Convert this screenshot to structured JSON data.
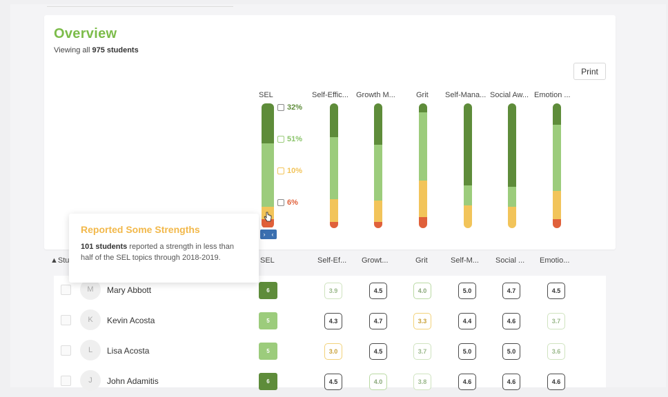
{
  "overview": {
    "title": "Overview",
    "subtitle_prefix": "Viewing all ",
    "subtitle_count": "975 students",
    "print_label": "Print"
  },
  "colors": {
    "dark_green": "#5e8c3a",
    "light_green": "#9ccc7c",
    "yellow": "#f2c45a",
    "red": "#e0603a"
  },
  "columns": [
    {
      "label": "SEL",
      "segments": [
        0.32,
        0.51,
        0.1,
        0.06
      ]
    },
    {
      "label": "Self-Effic...",
      "segments": [
        0.27,
        0.5,
        0.18,
        0.05
      ]
    },
    {
      "label": "Growth M...",
      "segments": [
        0.33,
        0.45,
        0.17,
        0.05
      ]
    },
    {
      "label": "Grit",
      "segments": [
        0.07,
        0.55,
        0.29,
        0.09
      ]
    },
    {
      "label": "Self-Mana...",
      "segments": [
        0.66,
        0.16,
        0.18,
        0.0
      ]
    },
    {
      "label": "Social Aw...",
      "segments": [
        0.67,
        0.16,
        0.17,
        0.0
      ]
    },
    {
      "label": "Emotion ...",
      "segments": [
        0.17,
        0.53,
        0.23,
        0.07
      ]
    }
  ],
  "sel_percents": [
    "32%",
    "51%",
    "10%",
    "6%"
  ],
  "tooltip": {
    "title": "Reported Some Strengths",
    "count": "101 students",
    "body": " reported a strength in less than half of the SEL topics through 2018-2019."
  },
  "table": {
    "headers": [
      "Stu",
      "SEL",
      "Self-Ef...",
      "Growt...",
      "Grit",
      "Self-M...",
      "Social ...",
      "Emotio..."
    ],
    "rows": [
      {
        "initial": "M",
        "name": "Mary Abbott",
        "sel": "6",
        "scores": [
          "3.9",
          "4.5",
          "4.0",
          "5.0",
          "4.7",
          "4.5"
        ]
      },
      {
        "initial": "K",
        "name": "Kevin Acosta",
        "sel": "5",
        "scores": [
          "4.3",
          "4.7",
          "3.3",
          "4.4",
          "4.6",
          "3.7"
        ]
      },
      {
        "initial": "L",
        "name": "Lisa Acosta",
        "sel": "5",
        "scores": [
          "3.0",
          "4.5",
          "3.7",
          "5.0",
          "5.0",
          "3.6"
        ]
      },
      {
        "initial": "J",
        "name": "John Adamitis",
        "sel": "6",
        "scores": [
          "4.5",
          "4.0",
          "3.8",
          "4.6",
          "4.6",
          "4.6"
        ]
      }
    ]
  }
}
